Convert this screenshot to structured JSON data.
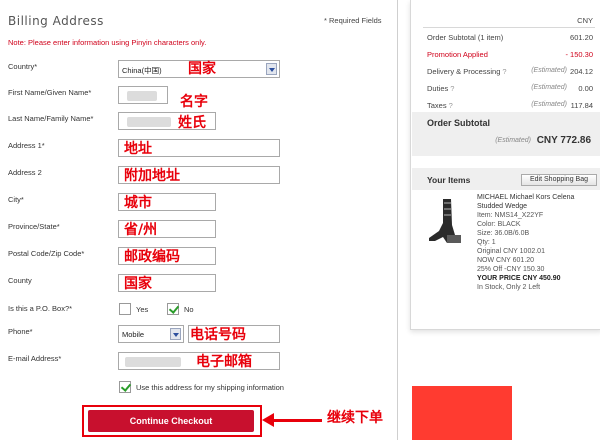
{
  "form": {
    "title": "Billing Address",
    "required_note": "* Required Fields",
    "pinyin_note": "Note: Please enter information using Pinyin characters only.",
    "fields": {
      "country": {
        "label": "Country*",
        "value": "China(中国)",
        "annotation": "国家"
      },
      "first_name": {
        "label": "First Name/Given Name*",
        "annotation": "名字"
      },
      "last_name": {
        "label": "Last Name/Family Name*",
        "annotation": "姓氏"
      },
      "address1": {
        "label": "Address 1*",
        "annotation": "地址"
      },
      "address2": {
        "label": "Address 2",
        "annotation": "附加地址"
      },
      "city": {
        "label": "City*",
        "annotation": "城市"
      },
      "province": {
        "label": "Province/State*",
        "annotation": "省/州"
      },
      "postal": {
        "label": "Postal Code/Zip Code*",
        "annotation": "邮政编码"
      },
      "county": {
        "label": "County",
        "annotation": "国家"
      },
      "po_box": {
        "label": "Is this a P.O. Box?*",
        "yes_label": "Yes",
        "no_label": "No",
        "selected": "No"
      },
      "phone": {
        "label": "Phone*",
        "type_value": "Mobile",
        "annotation": "电话号码"
      },
      "email": {
        "label": "E-mail Address*",
        "annotation": "电子邮箱"
      }
    },
    "shipping_checkbox_label": "Use this address for my shipping information",
    "continue_button_label": "Continue Checkout",
    "continue_annotation": "继续下单"
  },
  "summary": {
    "currency": "CNY",
    "rows": [
      {
        "label": "Order Subtotal (1 item)",
        "estimated": "",
        "value": "601.20",
        "help": "",
        "highlight": false
      },
      {
        "label": "Promotion Applied",
        "estimated": "",
        "value": "- 150.30",
        "help": "",
        "highlight": true
      },
      {
        "label": "Delivery & Processing",
        "estimated": "(Estimated)",
        "value": "204.12",
        "help": "?",
        "highlight": false
      },
      {
        "label": "Duties",
        "estimated": "(Estimated)",
        "value": "0.00",
        "help": "?",
        "highlight": false
      },
      {
        "label": "Taxes",
        "estimated": "(Estimated)",
        "value": "117.84",
        "help": "?",
        "highlight": false
      }
    ],
    "subtotal_title": "Order Subtotal",
    "subtotal_estimated": "(Estimated)",
    "subtotal_value": "CNY 772.86",
    "items_title": "Your Items",
    "edit_bag_label": "Edit Shopping Bag",
    "item": {
      "name_line1": "MICHAEL Michael Kors Celena",
      "name_line2": "Studded Wedge",
      "item_no": "Item: NMS14_X22YF",
      "color": "Color: BLACK",
      "size": "Size: 36.0B/6.0B",
      "qty": "Qty: 1",
      "original": "Original CNY 1002.01",
      "now": "NOW CNY 601.20",
      "discount": "25% Off -CNY 150.30",
      "your_price": "YOUR PRICE CNY 450.90",
      "stock": "In Stock, Only 2 Left"
    }
  },
  "colors": {
    "accent_red": "#c8102e",
    "annotation_red": "#e8000b",
    "check_green": "#2a9d2a"
  }
}
